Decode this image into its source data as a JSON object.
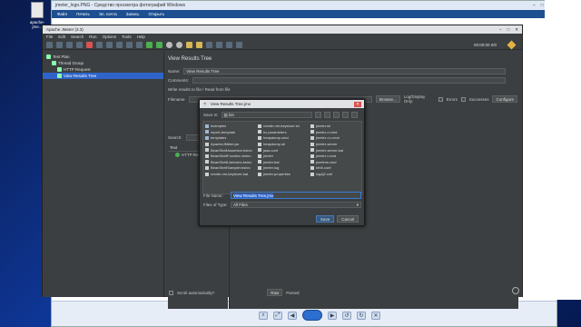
{
  "desktop": {
    "icon_label": "apache-jme...",
    "hero_text": "st"
  },
  "viewer": {
    "title": "jmeter_logo.PNG - Средство просмотра фотографий Windows",
    "menu": [
      "Файл",
      "Печать",
      "Эл. почта",
      "Запись",
      "Открыть"
    ]
  },
  "jmeter": {
    "title": "Apache JMeter (3.3)",
    "menu": [
      "File",
      "Edit",
      "Search",
      "Run",
      "Options",
      "Tools",
      "Help"
    ],
    "status": "00:00:00  0/0",
    "tree": [
      "Test Plan",
      "Thread Group",
      "HTTP Request",
      "View Results Tree"
    ],
    "panel": {
      "title": "View Results Tree",
      "name_label": "Name:",
      "name_value": "View Results Tree",
      "comments_label": "Comments:",
      "write_label": "Write results to file / Read from file",
      "filename_label": "Filename",
      "browse": "Browse...",
      "logdisplay": "Log/Display Only:",
      "errors": "Errors",
      "successes": "Successes",
      "configure": "Configure",
      "search_label": "Search:",
      "results_header": "Text",
      "result_item": "HTTP Request",
      "scroll_auto": "Scroll automatically?",
      "raw": "Raw",
      "parsed": "Parsed"
    }
  },
  "dialog": {
    "title": "View Results Tree.jmx",
    "save_in_label": "Save In:",
    "save_in_value": "bin",
    "files": [
      [
        {
          "n": "examples",
          "d": true
        },
        {
          "n": "report-template",
          "d": true
        },
        {
          "n": "templates",
          "d": true
        },
        {
          "n": "ApacheJMeter.jar"
        },
        {
          "n": "BeanShellAssertion.bshrc"
        },
        {
          "n": "BeanShellFunction.bshrc"
        },
        {
          "n": "BeanShellListeners.bshrc"
        },
        {
          "n": "BeanShellSampler.bshrc"
        },
        {
          "n": "create-rmi-keystore.bat"
        }
      ],
      [
        {
          "n": "create-rmi-keystore.sh"
        },
        {
          "n": "hc.parameters"
        },
        {
          "n": "heapdump.cmd"
        },
        {
          "n": "heapdump.sh"
        },
        {
          "n": "jaas.conf"
        },
        {
          "n": "jmeter"
        },
        {
          "n": "jmeter.bat"
        },
        {
          "n": "jmeter.log"
        },
        {
          "n": "jmeter.properties"
        }
      ],
      [
        {
          "n": "jmeter.sh"
        },
        {
          "n": "jmeter-n.cmd"
        },
        {
          "n": "jmeter-n-r.cmd"
        },
        {
          "n": "jmeter-server"
        },
        {
          "n": "jmeter-server.bat"
        },
        {
          "n": "jmeter-t.cmd"
        },
        {
          "n": "jmeterw.cmd"
        },
        {
          "n": "krb5.conf"
        },
        {
          "n": "log4j2.xml"
        }
      ]
    ],
    "filename_label": "File Name:",
    "filename_value": "View Results Tree.jmx",
    "filetype_label": "Files of Type:",
    "filetype_value": "All Files",
    "save": "Save",
    "cancel": "Cancel"
  },
  "colors": {
    "accent": "#2f65ca",
    "jmeter_bg": "#3c3f41",
    "desktop": "#0f3aa0"
  }
}
